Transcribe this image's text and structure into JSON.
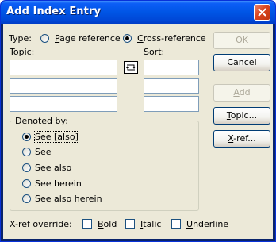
{
  "window": {
    "title": "Add Index Entry"
  },
  "type_row": {
    "label": "Type:",
    "options": [
      {
        "label": "Page reference",
        "selected": false
      },
      {
        "label": "Cross-reference",
        "selected": true
      }
    ]
  },
  "topic": {
    "label": "Topic:",
    "fields": [
      "",
      "",
      ""
    ]
  },
  "sort": {
    "label": "Sort:",
    "fields": [
      "",
      "",
      ""
    ]
  },
  "swap_icon": "swap-arrows-icon",
  "buttons": {
    "ok": "OK",
    "cancel": "Cancel",
    "add": "Add",
    "topic": "Topic...",
    "xref": "X-ref..."
  },
  "denoted_by": {
    "label": "Denoted by:",
    "options": [
      {
        "label": "See [also]",
        "selected": true
      },
      {
        "label": "See",
        "selected": false
      },
      {
        "label": "See also",
        "selected": false
      },
      {
        "label": "See herein",
        "selected": false
      },
      {
        "label": "See also herein",
        "selected": false
      }
    ]
  },
  "xref_override": {
    "label": "X-ref override:",
    "options": [
      {
        "label": "Bold",
        "checked": false
      },
      {
        "label": "Italic",
        "checked": false
      },
      {
        "label": "Underline",
        "checked": false
      }
    ]
  },
  "colors": {
    "titlebar": "#0055e5",
    "dialog_bg": "#ece9d8",
    "close": "#d9451f"
  }
}
